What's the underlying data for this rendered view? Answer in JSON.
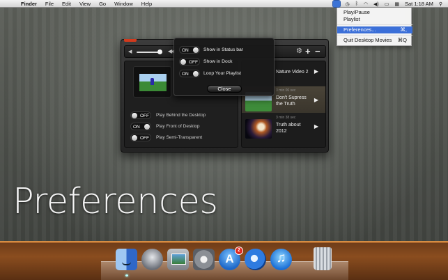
{
  "menubar": {
    "apple_glyph": "",
    "app_name": "Finder",
    "menus": [
      "File",
      "Edit",
      "View",
      "Go",
      "Window",
      "Help"
    ],
    "clock": "Sat 1:18 AM"
  },
  "status_menu": {
    "items": [
      {
        "label": "Play/Pause",
        "shortcut": ""
      },
      {
        "label": "Playlist",
        "shortcut": ""
      },
      {
        "label": "Preferences...",
        "shortcut": "⌘,"
      },
      {
        "label": "Quit Desktop Movies",
        "shortcut": "⌘Q"
      }
    ]
  },
  "player": {
    "options": [
      {
        "state": "OFF",
        "label": "Play Behind the Desktop"
      },
      {
        "state": "ON",
        "label": "Play Front of Desktop"
      },
      {
        "state": "OFF",
        "label": "Play Semi-Transparent"
      }
    ],
    "playlist": [
      {
        "meta": "",
        "title": "Nature Video 2"
      },
      {
        "meta": "3 min 06 sec",
        "title": "Don't Supress the Truth"
      },
      {
        "meta": "3 min 38 sec",
        "title": "Truth about 2012"
      }
    ]
  },
  "prefs": {
    "options": [
      {
        "state": "ON",
        "label": "Show in Status bar"
      },
      {
        "state": "OFF",
        "label": "Show in Dock"
      },
      {
        "state": "ON",
        "label": "Loop Your Playlist"
      }
    ],
    "close_label": "Close"
  },
  "overlay_title": "Preferences",
  "dock": {
    "appstore_badge": "2"
  },
  "colors": {
    "menu_highlight": "#3b6fd8",
    "window_red_tab": "#d23a1d",
    "floor": "#8a4d1f"
  }
}
